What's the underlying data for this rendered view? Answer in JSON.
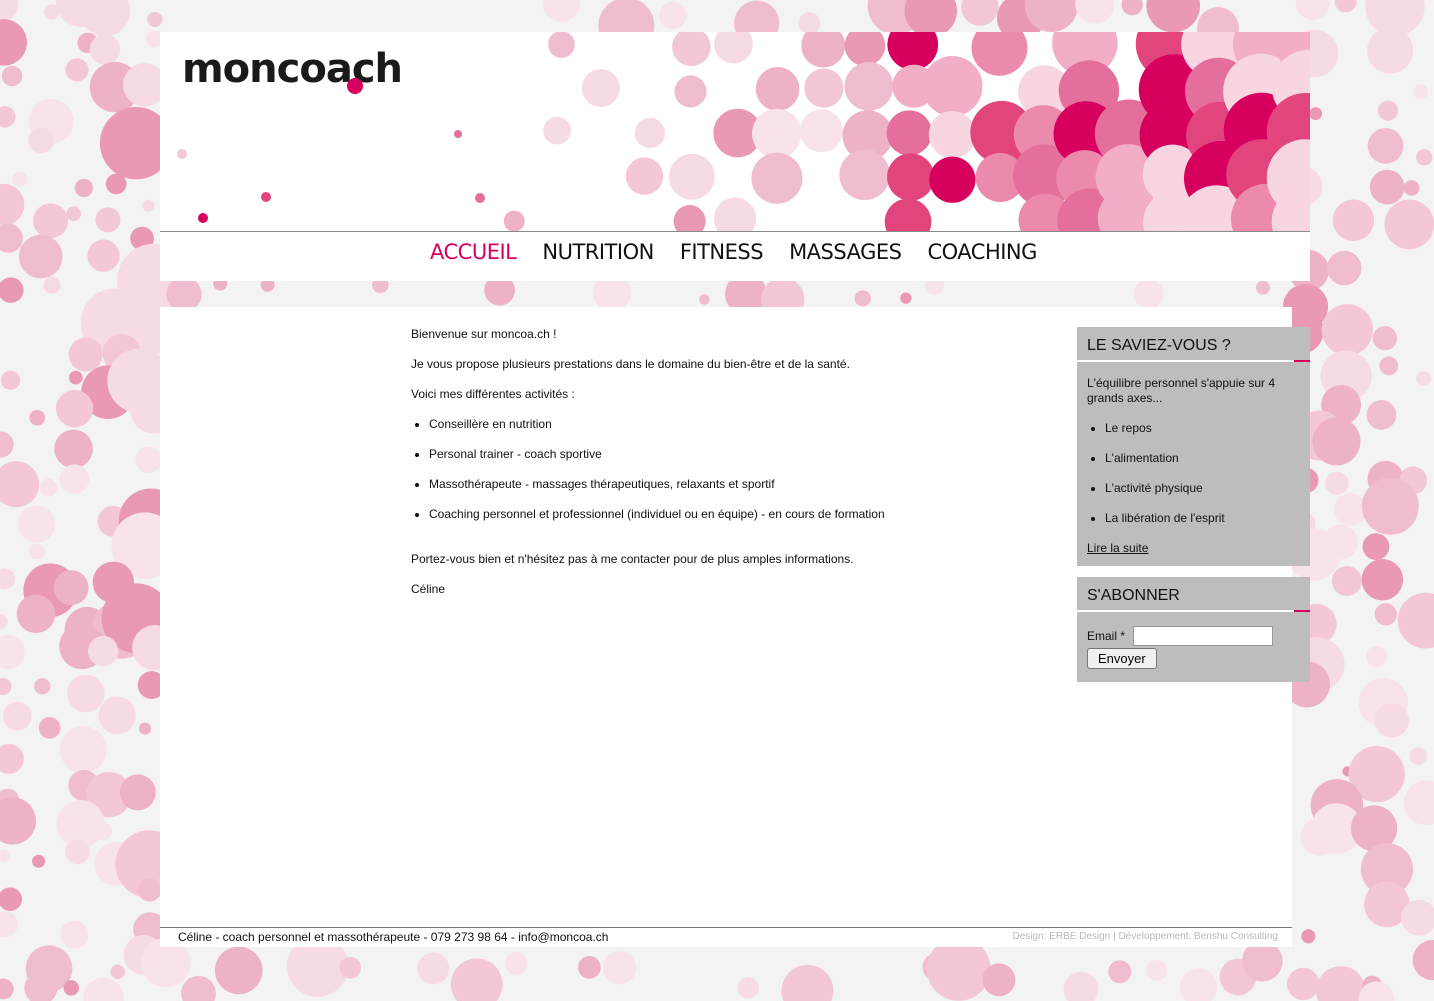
{
  "brand": {
    "logo_text": "moncoach",
    "accent_color": "#d8005f"
  },
  "nav": {
    "items": [
      {
        "label": "ACCUEIL",
        "active": true
      },
      {
        "label": "NUTRITION",
        "active": false
      },
      {
        "label": "FITNESS",
        "active": false
      },
      {
        "label": "MASSAGES",
        "active": false
      },
      {
        "label": "COACHING",
        "active": false
      }
    ]
  },
  "content": {
    "welcome": "Bienvenue sur moncoa.ch !",
    "intro": "Je vous propose plusieurs prestations dans le domaine du bien-être et de la santé.",
    "activities_heading": "Voici mes différentes activités :",
    "activities": [
      "Conseillère en nutrition",
      "Personal trainer - coach sportive",
      "Massothérapeute - massages thérapeutiques, relaxants et sportif",
      "Coaching personnel et professionnel (individuel ou en équipe) - en cours de formation"
    ],
    "closing": "Portez-vous bien et n'hésitez pas à me contacter pour de plus amples informations.",
    "signature": "Céline"
  },
  "sidebar": {
    "did_you_know": {
      "title": "LE SAVIEZ-VOUS ?",
      "intro": "L'équilibre personnel s'appuie sur 4 grands axes...",
      "items": [
        "Le repos",
        "L'alimentation",
        "L'activité physique",
        "La libération de l'esprit"
      ],
      "read_more": "Lire la suite"
    },
    "subscribe": {
      "title": "S'ABONNER",
      "email_label": "Email *",
      "email_value": "",
      "button_label": "Envoyer"
    }
  },
  "footer": {
    "contact": "Céline - coach personnel et massothérapeute - 079 273 98 64 - info@moncoa.ch",
    "credits": "Design: ERBE Design | Développement: Benshu Consulting"
  }
}
